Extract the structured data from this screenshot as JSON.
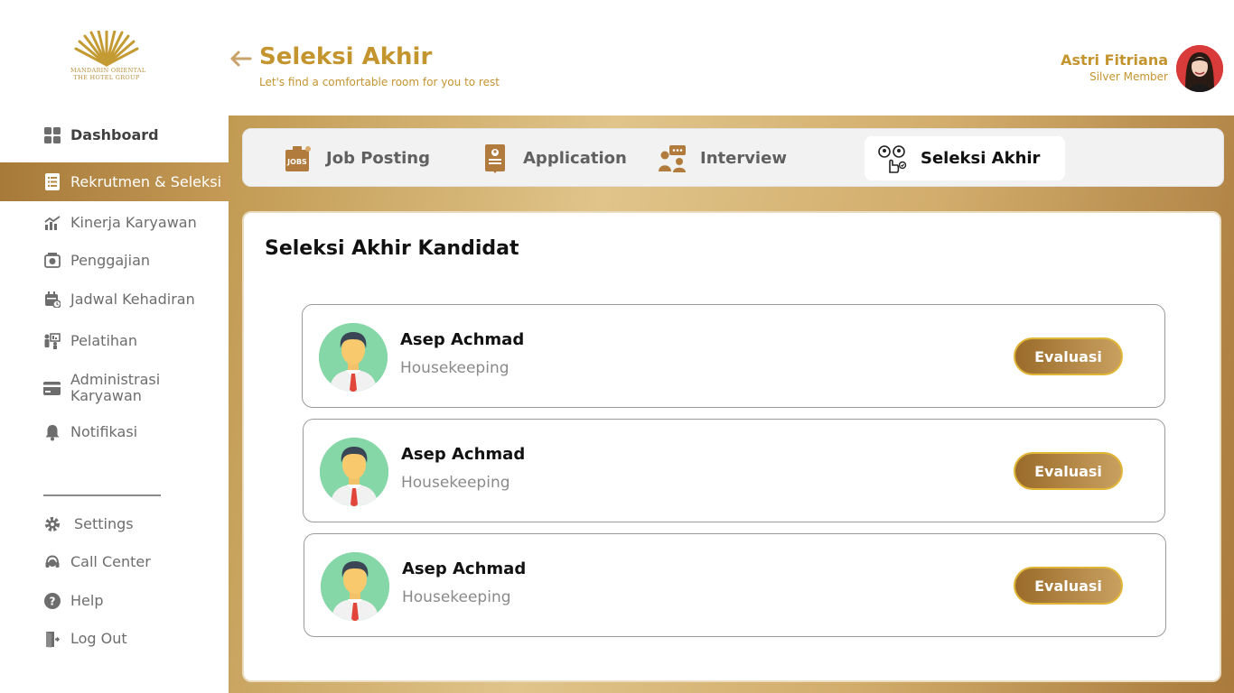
{
  "brand": {
    "line1": "MANDARIN ORIENTAL",
    "line2": "THE HOTEL GROUP"
  },
  "header": {
    "title": "Seleksi Akhir",
    "subtitle": "Let's find a comfortable room for you to rest"
  },
  "user": {
    "name": "Astri Fitriana",
    "role": "Silver Member"
  },
  "sidebar": {
    "items": [
      {
        "label": "Dashboard",
        "icon": "dashboard-grid-icon"
      },
      {
        "label": "Rekrutmen & Seleksi",
        "icon": "document-list-icon",
        "active": true
      },
      {
        "label": "Kinerja Karyawan",
        "icon": "chart-growth-icon"
      },
      {
        "label": "Penggajian",
        "icon": "payroll-icon"
      },
      {
        "label": "Jadwal Kehadiran",
        "icon": "calendar-clock-icon"
      },
      {
        "label": "Pelatihan",
        "icon": "training-presentation-icon"
      },
      {
        "label": "Administrasi Karyawan",
        "icon": "card-icon"
      },
      {
        "label": "Notifikasi",
        "icon": "bell-icon"
      }
    ],
    "bottom_items": [
      {
        "label": "Settings",
        "icon": "gear-icon"
      },
      {
        "label": "Call Center",
        "icon": "headset-icon"
      },
      {
        "label": "Help",
        "icon": "help-circle-icon"
      },
      {
        "label": "Log Out",
        "icon": "logout-door-icon"
      }
    ]
  },
  "tabs": [
    {
      "label": "Job Posting",
      "icon": "jobs-board-icon"
    },
    {
      "label": "Application",
      "icon": "application-form-icon"
    },
    {
      "label": "Interview",
      "icon": "interview-chat-icon"
    },
    {
      "label": "Seleksi Akhir",
      "icon": "candidate-select-icon",
      "active": true
    }
  ],
  "section": {
    "title": "Seleksi Akhir Kandidat"
  },
  "candidates": [
    {
      "name": "Asep Achmad",
      "role": "Housekeeping",
      "button": "Evaluasi"
    },
    {
      "name": "Asep Achmad",
      "role": "Housekeeping",
      "button": "Evaluasi"
    },
    {
      "name": "Asep Achmad",
      "role": "Housekeeping",
      "button": "Evaluasi"
    }
  ],
  "colors": {
    "gold": "#c4942f",
    "active_nav": "#a77a3a",
    "button_border": "#e0b637",
    "avatar_bg": "#86d7a7"
  }
}
